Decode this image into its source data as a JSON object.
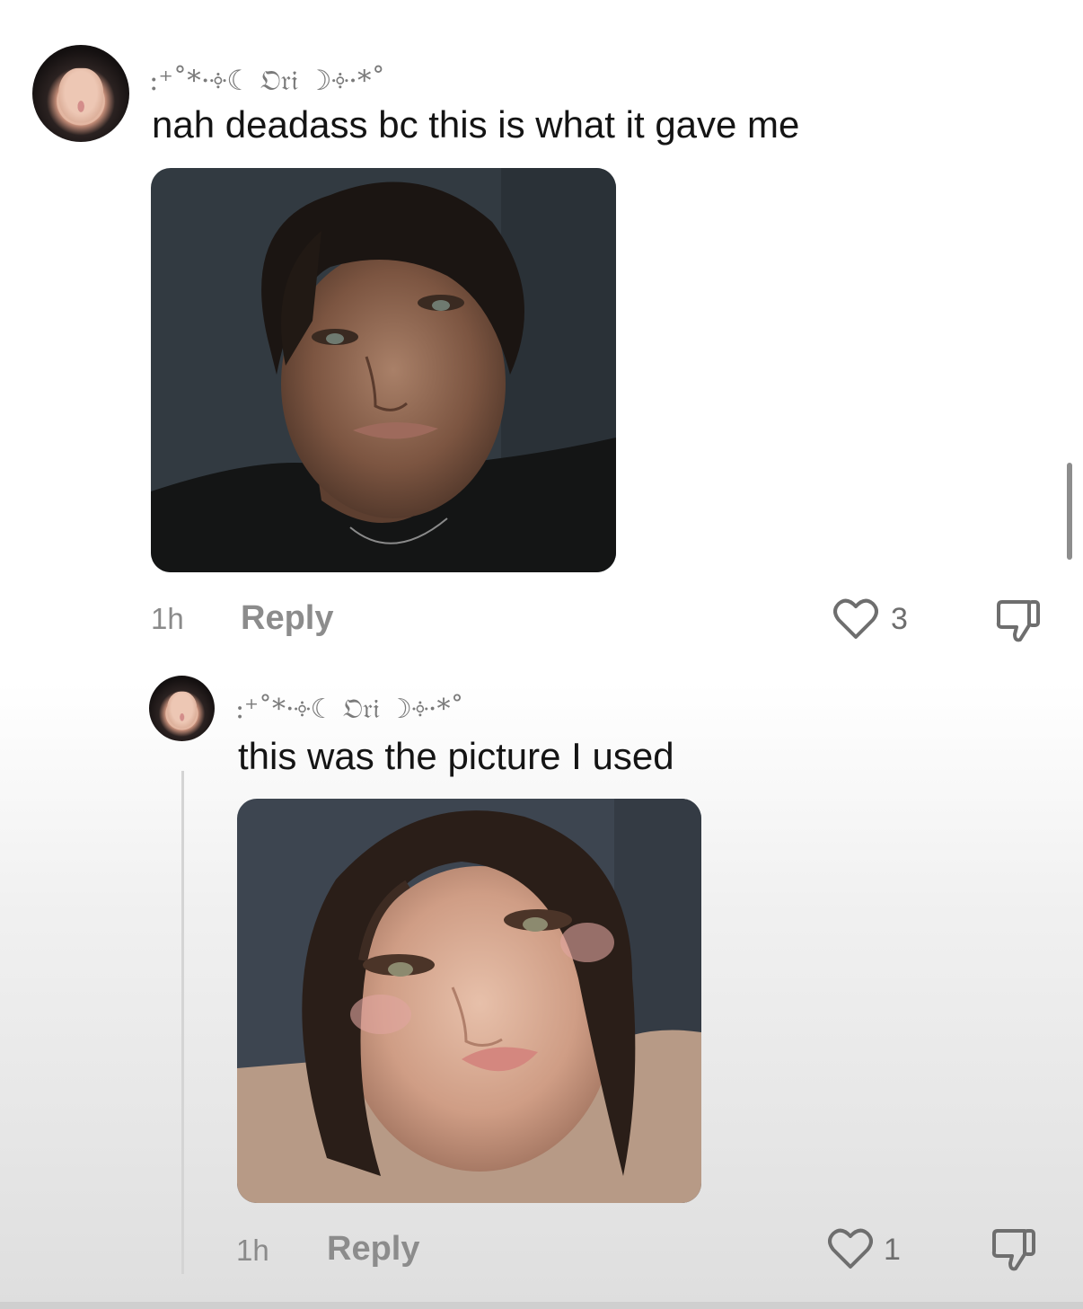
{
  "comments": [
    {
      "username": ":⁺˚*·༓☾ 𝔒𝔯𝔦 ☽༓·*˚",
      "text": "nah deadass bc this is what it gave me",
      "time": "1h",
      "reply_label": "Reply",
      "likes": "3"
    },
    {
      "username": ":⁺˚*·༓☾ 𝔒𝔯𝔦 ☽༓·*˚",
      "text": "this was the picture I used",
      "time": "1h",
      "reply_label": "Reply",
      "likes": "1"
    }
  ],
  "icons": {
    "like": "heart-outline-icon",
    "dislike": "thumbs-down-icon"
  },
  "colors": {
    "text": "#141414",
    "meta": "#8a8a8a",
    "thread_line": "#d4d4d4"
  }
}
